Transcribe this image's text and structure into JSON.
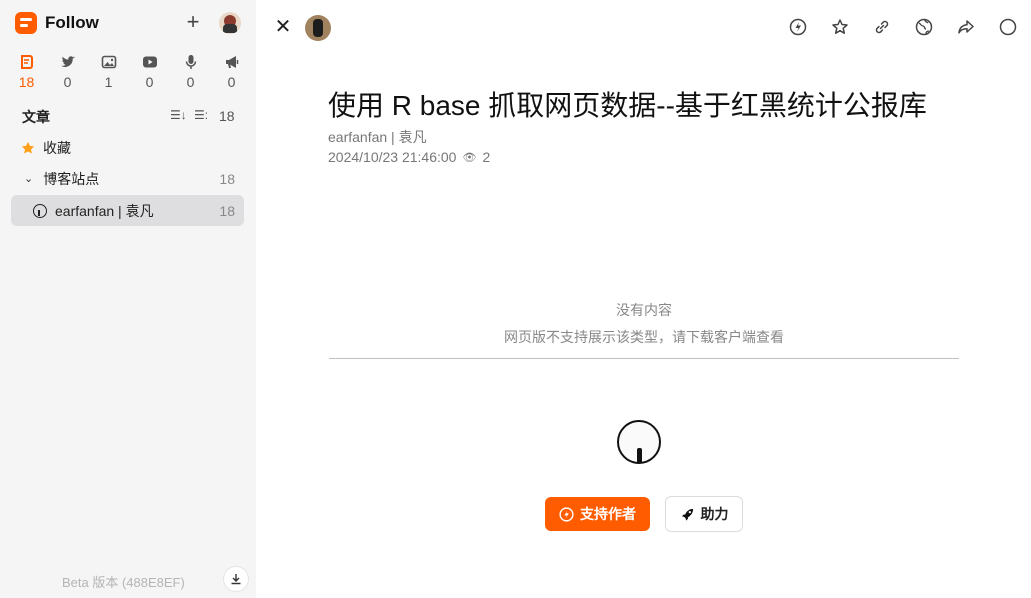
{
  "app": {
    "name": "Follow"
  },
  "views": [
    {
      "icon": "article-icon",
      "count": "18",
      "active": true
    },
    {
      "icon": "twitter-icon",
      "count": "0"
    },
    {
      "icon": "picture-icon",
      "count": "1"
    },
    {
      "icon": "video-icon",
      "count": "0"
    },
    {
      "icon": "microphone-icon",
      "count": "0"
    },
    {
      "icon": "megaphone-icon",
      "count": "0"
    }
  ],
  "section": {
    "title": "文章",
    "count": "18"
  },
  "sidebar": {
    "favorites": {
      "label": "收藏"
    },
    "category": {
      "label": "博客站点",
      "count": "18"
    },
    "feed": {
      "label": "earfanfan | 袁凡",
      "count": "18"
    }
  },
  "footer": {
    "version": "Beta 版本 (488E8EF)"
  },
  "article": {
    "title": "使用 R base 抓取网页数据--基于红黑统计公报库",
    "author": "earfanfan | 袁凡",
    "date": "2024/10/23 21:46:00",
    "views": "2"
  },
  "empty": {
    "title": "没有内容",
    "subtitle": "网页版不支持展示该类型，请下载客户端查看"
  },
  "buttons": {
    "support": "支持作者",
    "boost": "助力"
  },
  "colors": {
    "accent": "#ff5c00",
    "sidebar_bg": "#f5f5f5"
  }
}
